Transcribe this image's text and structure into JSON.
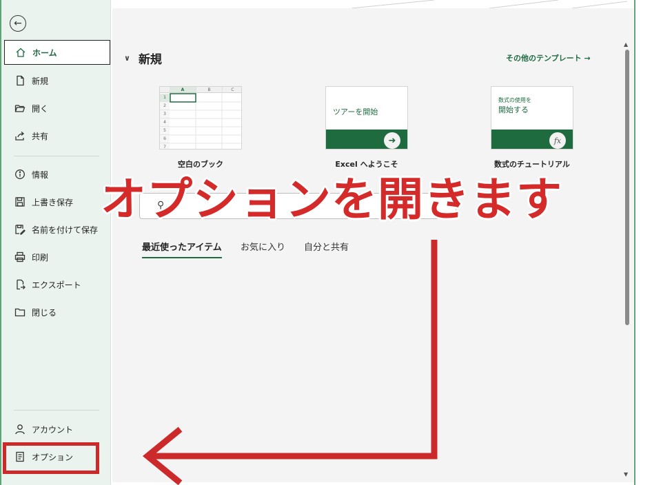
{
  "sidebar": {
    "items": [
      {
        "label": "ホーム",
        "icon": "home-icon",
        "active": true
      },
      {
        "label": "新規",
        "icon": "new-document-icon"
      },
      {
        "label": "開く",
        "icon": "folder-open-icon"
      },
      {
        "label": "共有",
        "icon": "share-icon"
      },
      {
        "label": "情報",
        "icon": "info-icon"
      },
      {
        "label": "上書き保存",
        "icon": "save-icon"
      },
      {
        "label": "名前を付けて保存",
        "icon": "save-as-icon"
      },
      {
        "label": "印刷",
        "icon": "print-icon"
      },
      {
        "label": "エクスポート",
        "icon": "export-icon"
      },
      {
        "label": "閉じる",
        "icon": "folder-close-icon"
      },
      {
        "label": "アカウント",
        "icon": "person-icon"
      },
      {
        "label": "オプション",
        "icon": "options-icon"
      }
    ]
  },
  "main": {
    "section_title": "新規",
    "more_templates": "その他のテンプレート →",
    "templates": [
      {
        "label": "空白のブック",
        "columns": [
          "A",
          "B",
          "C"
        ],
        "rows": [
          "1",
          "2",
          "3",
          "4",
          "5",
          "6",
          "7"
        ]
      },
      {
        "label": "Excel へようこそ",
        "tile_text": "ツアーを開始"
      },
      {
        "label": "数式のチュートリアル",
        "tile_text_small": "数式の使用を",
        "tile_text_large": "開始する",
        "badge": "fx"
      }
    ],
    "tabs": [
      {
        "label": "最近使ったアイテム",
        "active": true
      },
      {
        "label": "お気に入り"
      },
      {
        "label": "自分と共有"
      }
    ]
  },
  "annotation": {
    "text": "オプションを開きます",
    "color": "#d42a2a"
  },
  "colors": {
    "accent": "#1d6b3f",
    "sidebar_bg": "#eaf3ee",
    "highlight": "#cc2a2a"
  }
}
